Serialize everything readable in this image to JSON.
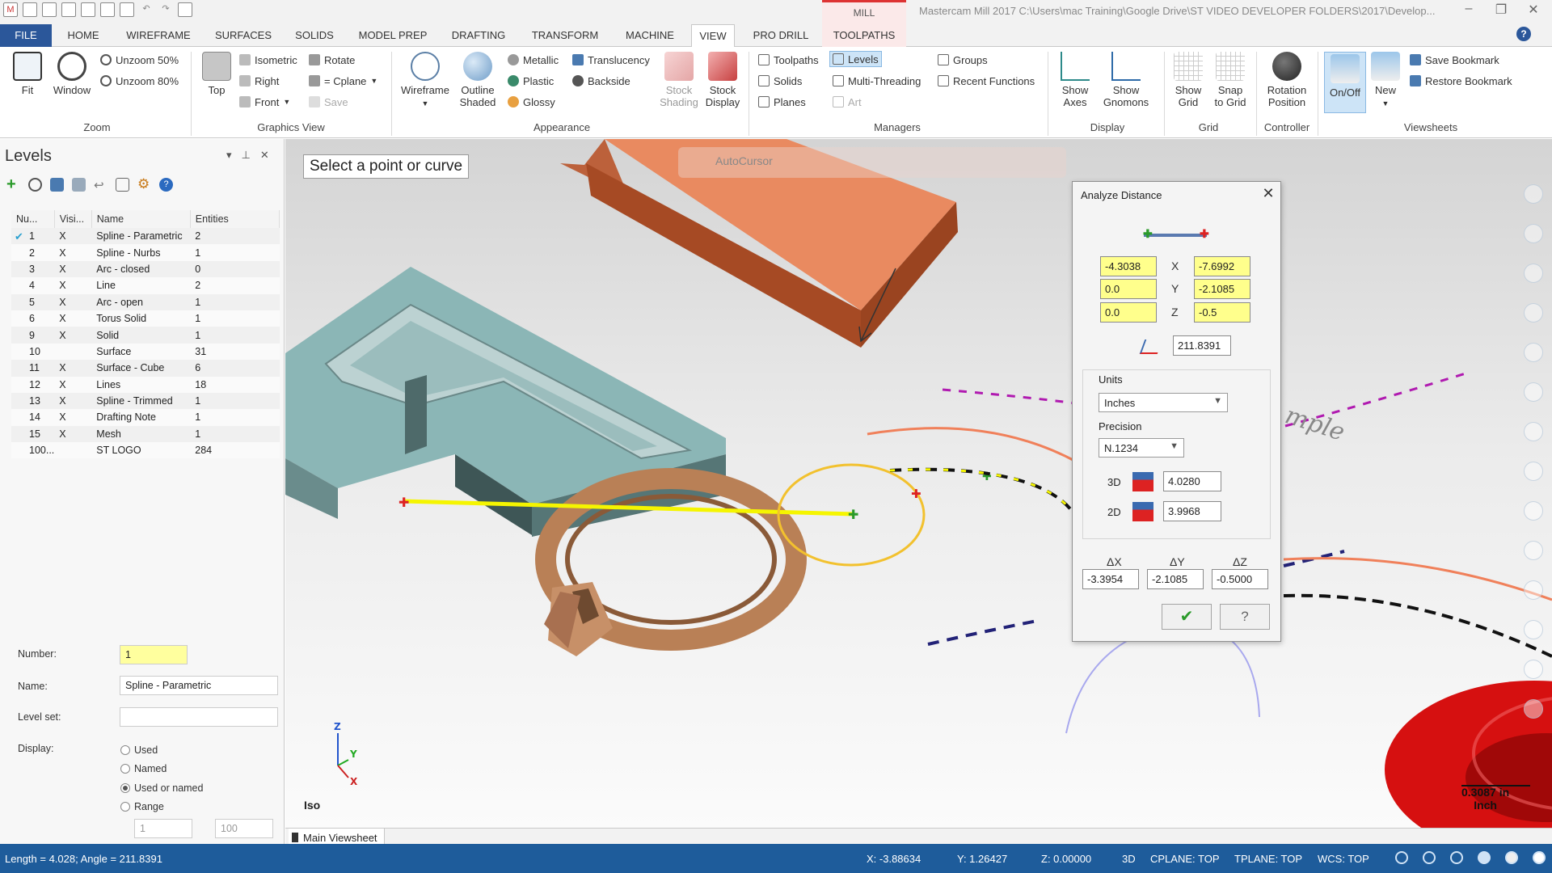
{
  "window": {
    "title": "Mastercam Mill 2017  C:\\Users\\mac Training\\Google Drive\\ST VIDEO DEVELOPER FOLDERS\\2017\\Develop...",
    "context_tab": "MILL",
    "controls": {
      "minimize": "–",
      "maximize": "❐",
      "close": "✕"
    }
  },
  "ribbon": {
    "tabs": [
      "FILE",
      "HOME",
      "WIREFRAME",
      "SURFACES",
      "SOLIDS",
      "MODEL PREP",
      "DRAFTING",
      "TRANSFORM",
      "MACHINE",
      "VIEW",
      "PRO DRILL",
      "TOOLPATHS"
    ],
    "active_tab": "VIEW",
    "help": "?",
    "zoom": {
      "fit": "Fit",
      "window": "Window",
      "unzoom50": "Unzoom 50%",
      "unzoom80": "Unzoom 80%",
      "label": "Zoom"
    },
    "graphics_view": {
      "top": "Top",
      "isometric": "Isometric",
      "right": "Right",
      "front": "Front",
      "rotate": "Rotate",
      "cplane": "= Cplane",
      "save": "Save",
      "label": "Graphics View"
    },
    "appearance": {
      "wireframe": "Wireframe",
      "outline": "Outline",
      "shaded": "Shaded",
      "metallic": "Metallic",
      "plastic": "Plastic",
      "glossy": "Glossy",
      "translucency": "Translucency",
      "backside": "Backside",
      "stock_shading_1": "Stock",
      "stock_shading_2": "Shading",
      "stock_display_1": "Stock",
      "stock_display_2": "Display",
      "label": "Appearance"
    },
    "managers": {
      "toolpaths": "Toolpaths",
      "solids": "Solids",
      "planes": "Planes",
      "levels": "Levels",
      "multithreading": "Multi-Threading",
      "art": "Art",
      "groups": "Groups",
      "recent": "Recent Functions",
      "label": "Managers"
    },
    "display": {
      "axes_1": "Show",
      "axes_2": "Axes",
      "gnomons_1": "Show",
      "gnomons_2": "Gnomons",
      "label": "Display"
    },
    "grid": {
      "show_1": "Show",
      "show_2": "Grid",
      "snap_1": "Snap",
      "snap_2": "to Grid",
      "label": "Grid"
    },
    "controller": {
      "rotation_1": "Rotation",
      "rotation_2": "Position",
      "label": "Controller"
    },
    "viewsheets": {
      "onoff": "On/Off",
      "new": "New",
      "save_bookmark": "Save Bookmark",
      "restore_bookmark": "Restore Bookmark",
      "label": "Viewsheets"
    }
  },
  "levels_panel": {
    "title": "Levels",
    "columns": [
      "Nu...",
      "Visi...",
      "Name",
      "Entities"
    ],
    "rows": [
      {
        "num": "1",
        "vis": "X",
        "name": "Spline - Parametric",
        "entities": "2"
      },
      {
        "num": "2",
        "vis": "X",
        "name": "Spline - Nurbs",
        "entities": "1"
      },
      {
        "num": "3",
        "vis": "X",
        "name": "Arc - closed",
        "entities": "0"
      },
      {
        "num": "4",
        "vis": "X",
        "name": "Line",
        "entities": "2"
      },
      {
        "num": "5",
        "vis": "X",
        "name": "Arc - open",
        "entities": "1"
      },
      {
        "num": "6",
        "vis": "X",
        "name": "Torus Solid",
        "entities": "1"
      },
      {
        "num": "9",
        "vis": "X",
        "name": "Solid",
        "entities": "1"
      },
      {
        "num": "10",
        "vis": "",
        "name": "Surface",
        "entities": "31"
      },
      {
        "num": "11",
        "vis": "X",
        "name": "Surface - Cube",
        "entities": "6"
      },
      {
        "num": "12",
        "vis": "X",
        "name": "Lines",
        "entities": "18"
      },
      {
        "num": "13",
        "vis": "X",
        "name": "Spline - Trimmed",
        "entities": "1"
      },
      {
        "num": "14",
        "vis": "X",
        "name": "Drafting Note",
        "entities": "1"
      },
      {
        "num": "15",
        "vis": "X",
        "name": "Mesh",
        "entities": "1"
      },
      {
        "num": "100...",
        "vis": "",
        "name": "ST LOGO",
        "entities": "284"
      }
    ],
    "number_label": "Number:",
    "number_value": "1",
    "name_label": "Name:",
    "name_value": "Spline - Parametric",
    "levelset_label": "Level set:",
    "levelset_value": "",
    "display_label": "Display:",
    "display_options": [
      "Used",
      "Named",
      "Used or named",
      "Range"
    ],
    "display_selected": "Used or named",
    "range_from": "1",
    "range_to": "100"
  },
  "viewport": {
    "prompt": "Select a point or curve",
    "autocursor": "AutoCursor",
    "view_name": "Iso",
    "axis_z": "Z",
    "axis_y": "Y",
    "axis_x": "X",
    "scale_value": "0.3087 in",
    "scale_unit": "Inch",
    "text_fragment": "mple"
  },
  "dialog": {
    "title": "Analyze Distance",
    "close": "✕",
    "p1": {
      "x": "-4.3038",
      "y": "0.0",
      "z": "0.0"
    },
    "p2": {
      "x": "-7.6992",
      "y": "-2.1085",
      "z": "-0.5"
    },
    "axis_labels": {
      "x": "X",
      "y": "Y",
      "z": "Z"
    },
    "angle": "211.8391",
    "units_label": "Units",
    "units_value": "Inches",
    "precision_label": "Precision",
    "precision_value": "N.1234",
    "dist3d_label": "3D",
    "dist3d": "4.0280",
    "dist2d_label": "2D",
    "dist2d": "3.9968",
    "delta_labels": {
      "dx": "ΔX",
      "dy": "ΔY",
      "dz": "ΔZ"
    },
    "dx": "-3.3954",
    "dy": "-2.1085",
    "dz": "-0.5000",
    "ok": "✔",
    "help": "?"
  },
  "bottom": {
    "viewsheet_tab": "Main Viewsheet"
  },
  "status": {
    "left": "Length = 4.028; Angle = 211.8391",
    "x": "X:  -3.88634",
    "y": "Y:  1.26427",
    "z": "Z:  0.00000",
    "mode": "3D",
    "cplane": "CPLANE: TOP",
    "tplane": "TPLANE: TOP",
    "wcs": "WCS: TOP"
  },
  "colors": {
    "file_tab": "#2b579a",
    "status_bar": "#1e5c9b",
    "field_yellow": "#ffff8c",
    "analyze_line": "#f5f500",
    "block_orange": "#e07a50",
    "solid_teal": "#7fa8a8",
    "torus_red": "#dd1111"
  }
}
